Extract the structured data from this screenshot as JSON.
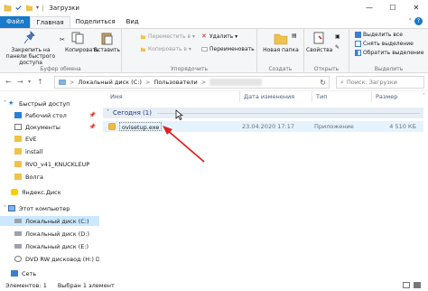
{
  "window": {
    "title": "Загрузки",
    "controls": {
      "minimize": "—",
      "maximize": "☐",
      "close": "✕"
    }
  },
  "ribbon_tabs": {
    "file": "Файл",
    "home": "Главная",
    "share": "Поделиться",
    "view": "Вид"
  },
  "ribbon": {
    "clipboard": {
      "pin_label": "Закрепить на панели быстрого доступа",
      "copy": "Копировать",
      "paste": "Вставить",
      "group_label": "Буфер обмена"
    },
    "organize": {
      "move_to": "Переместить в ▾",
      "copy_to": "Копировать в ▾",
      "delete": "Удалить ▾",
      "rename": "Переименовать",
      "group_label": "Упорядочить"
    },
    "new": {
      "new_folder": "Новая папка",
      "group_label": "Создать"
    },
    "open": {
      "properties": "Свойства",
      "group_label": "Открыть"
    },
    "select": {
      "select_all": "Выделить все",
      "select_none": "Снять выделение",
      "invert": "Обратить выделение",
      "group_label": "Выделить"
    }
  },
  "address": {
    "crumbs": [
      "Локальный диск (C:)",
      "Пользователи"
    ],
    "separator": ">",
    "search_placeholder": "Поиск: Загрузки"
  },
  "nav": {
    "quick_access": "Быстрый доступ",
    "desktop": "Рабочий стол",
    "documents": "Документы",
    "eve": "EVE",
    "install": "install",
    "rvo": "RVO_v41_KNUCKLEUP",
    "volga": "Волга",
    "yandex_disk": "Яндекс.Диск",
    "this_pc": "Этот компьютер",
    "drive_c": "Локальный диск (C:)",
    "drive_d": "Локальный диск (D:)",
    "drive_e": "Локальный диск (E:)",
    "dvd": "DVD RW дисковод (H:) DRIV",
    "network": "Сеть"
  },
  "columns": {
    "name": "Имя",
    "date": "Дата изменения",
    "type": "Тип",
    "size": "Размер"
  },
  "group": {
    "label": "Сегодня (1)"
  },
  "files": [
    {
      "name": "ovisetup.exe",
      "date": "23.04.2020 17:17",
      "type": "Приложение",
      "size": "4 510 КБ"
    }
  ],
  "status": {
    "items": "Элементов: 1",
    "selected": "Выбран 1 элемент"
  },
  "colors": {
    "accent": "#1979ca",
    "selection": "#cce8ff",
    "arrow": "#e02020"
  }
}
